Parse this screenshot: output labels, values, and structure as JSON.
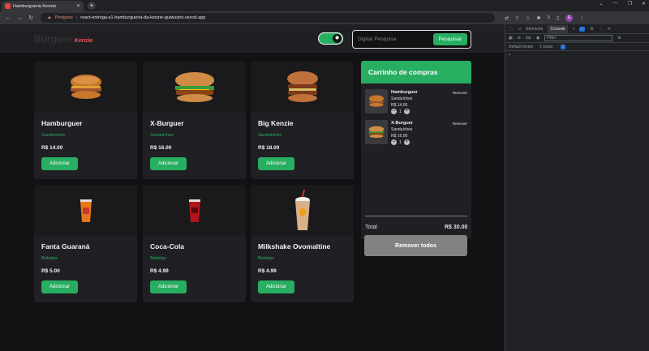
{
  "browser": {
    "tab_title": "Hamburgueria Kenzie",
    "insecure_label": "Perigoso",
    "url": "react-entrega-s1-hamburgueria-da-kenzie-guiwustro.vercel.app",
    "profile_initial": "G"
  },
  "header": {
    "logo_main": "Burguer",
    "logo_sub": "Kenzie",
    "search_placeholder": "Digitar Pesquisa",
    "search_button": "Pesquisar"
  },
  "products": [
    {
      "name": "Hamburguer",
      "category": "Sanduíches",
      "price": "R$ 14.00",
      "button": "Adicionar",
      "icon": "burger-icon"
    },
    {
      "name": "X-Burguer",
      "category": "Sanduíches",
      "price": "R$ 16.00",
      "button": "Adicionar",
      "icon": "cheeseburger-icon"
    },
    {
      "name": "Big Kenzie",
      "category": "Sanduíches",
      "price": "R$ 18.00",
      "button": "Adicionar",
      "icon": "double-burger-icon"
    },
    {
      "name": "Fanta Guaraná",
      "category": "Bebidas",
      "price": "R$ 5.00",
      "button": "Adicionar",
      "icon": "soda-cup-icon"
    },
    {
      "name": "Coca-Cola",
      "category": "Bebidas",
      "price": "R$ 4.99",
      "button": "Adicionar",
      "icon": "cola-cup-icon"
    },
    {
      "name": "Milkshake Ovomaltine",
      "category": "Bebidas",
      "price": "R$ 4.99",
      "button": "Adicionar",
      "icon": "milkshake-icon"
    }
  ],
  "cart": {
    "title": "Carrinho de compras",
    "items": [
      {
        "name": "Hamburguer",
        "category": "Sanduíches",
        "price": "R$ 14.00",
        "qty": "1",
        "remove": "Remover"
      },
      {
        "name": "X-Burguer",
        "category": "Sanduíches",
        "price": "R$ 16.00",
        "qty": "1",
        "remove": "Remover"
      }
    ],
    "total_label": "Total",
    "total_value": "R$ 30.00",
    "remove_all": "Remover todos"
  },
  "devtools": {
    "tab_elements": "Elements",
    "tab_console": "Console",
    "issues_count": "1",
    "context": "top",
    "filter_placeholder": "Filter",
    "levels": "Default levels",
    "issue_text": "1 Issue:",
    "issue_count_badge": "1"
  },
  "colors": {
    "brand_green": "#27ae60",
    "accent_red": "#eb5757",
    "background": "#121214",
    "card": "#202024"
  }
}
